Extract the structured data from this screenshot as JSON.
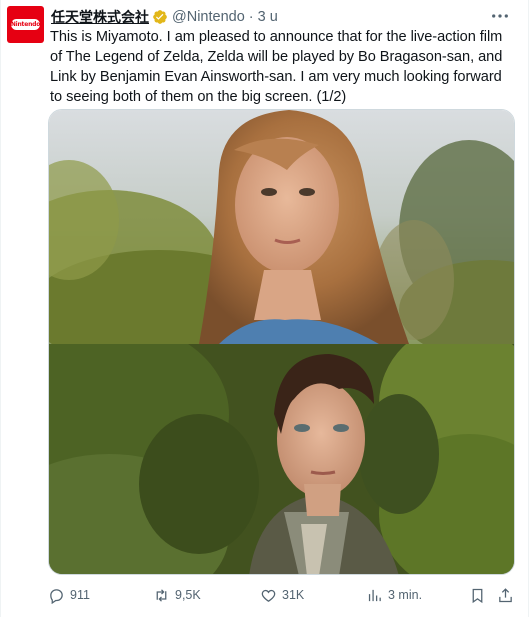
{
  "tweet": {
    "avatar_text": "Nintendo",
    "display_name": "任天堂株式会社",
    "handle": "@Nintendo",
    "separator": "·",
    "time": "3 u",
    "text": "This is Miyamoto. I am pleased to announce that for the live-action film of The Legend of Zelda, Zelda will be played by Bo Bragason-san, and Link by Benjamin Evan Ainsworth-san. I am very much looking forward to seeing both of them on the big screen. (1/2)"
  },
  "actions": {
    "replies": "911",
    "reposts": "9,5K",
    "likes": "31K",
    "views": "3 min."
  },
  "icons": {
    "verified": "verified-gold-badge-icon",
    "more": "more-horizontal-icon",
    "reply": "reply-icon",
    "repost": "repost-icon",
    "like": "heart-icon",
    "views": "views-bar-chart-icon",
    "bookmark": "bookmark-icon",
    "share": "share-icon"
  },
  "colors": {
    "brand_red": "#e60012",
    "verified_gold": "#e2b719",
    "secondary_text": "#536471"
  }
}
